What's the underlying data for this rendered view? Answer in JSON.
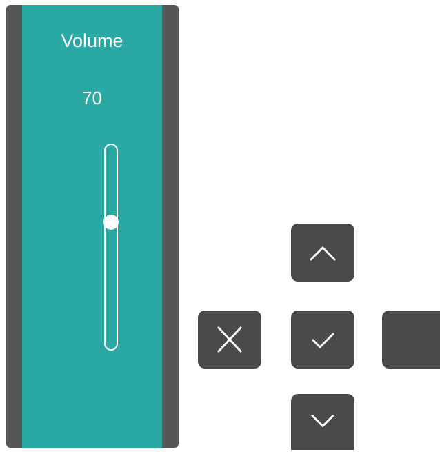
{
  "volume_panel": {
    "title": "Volume",
    "value": "70",
    "slider_level": 0.62
  },
  "colors": {
    "panel_frame": "#575757",
    "panel_fill": "#2aa8a3",
    "key_fill": "#4a4a4a",
    "foreground": "#ffffff"
  },
  "keys": [
    {
      "name": "up",
      "icon": "chevron-up-icon"
    },
    {
      "name": "cancel",
      "icon": "close-icon"
    },
    {
      "name": "ok",
      "icon": "check-icon"
    },
    {
      "name": "right",
      "icon": ""
    },
    {
      "name": "down",
      "icon": "chevron-down-icon"
    }
  ]
}
